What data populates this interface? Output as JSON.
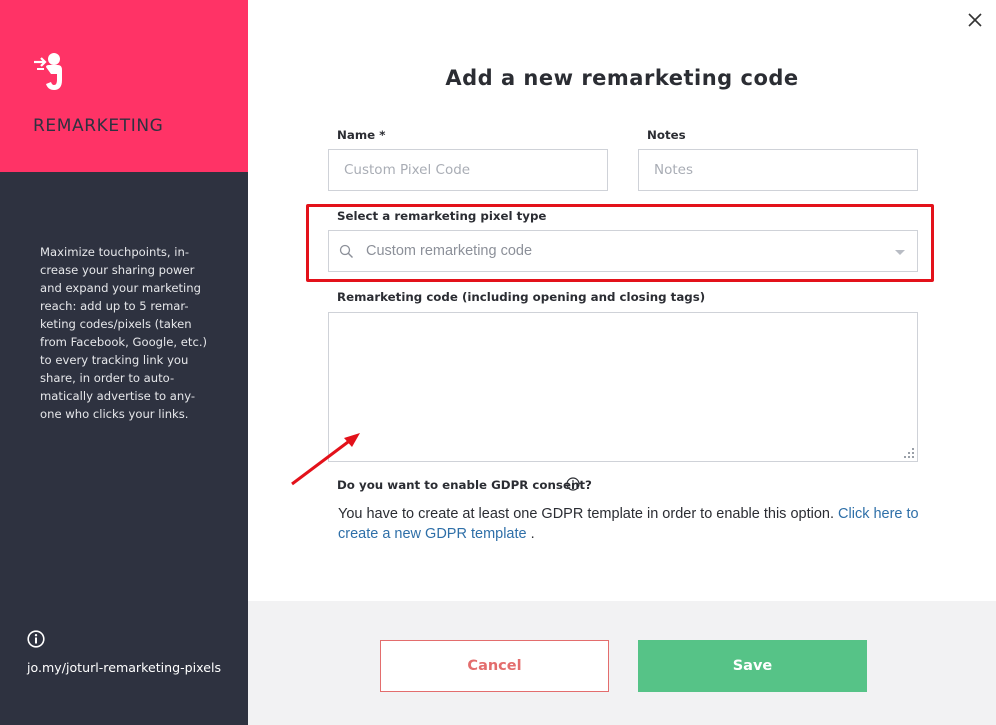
{
  "sidebar": {
    "brand_title": "REMARKETING",
    "description": "Maximize touchpoints, in-crease your sharing power and expand your marketing reach: add up to 5 remar-keting codes/pixels (taken from Facebook, Google, etc.) to every tracking link you share, in order to auto-matically advertise to any-one who clicks your links.",
    "help_link": "jo.my/joturl-remarketing-pixels",
    "colors": {
      "accent": "#ff3366",
      "dark": "#2e3240"
    }
  },
  "dialog": {
    "title": "Add a new remarketing code",
    "name_label": "Name *",
    "name_placeholder": "Custom Pixel Code",
    "notes_label": "Notes",
    "notes_placeholder": "Notes",
    "pixel_type_label": "Select a remarketing pixel type",
    "pixel_type_value": "Custom remarketing code",
    "code_label": "Remarketing code (including opening and closing tags)",
    "code_value": "",
    "gdpr_label": "Do you want to enable GDPR consent?",
    "gdpr_text": "You have to create at least one GDPR template in order to enable this option.",
    "gdpr_link": "Click here to create a new GDPR template",
    "gdpr_suffix": "."
  },
  "footer": {
    "cancel_label": "Cancel",
    "save_label": "Save",
    "colors": {
      "cancel": "#e36d6d",
      "save": "#56c387"
    }
  },
  "icons": {
    "brand": "remarketing-person-icon",
    "info": "info-icon",
    "close": "close-icon",
    "search": "search-icon"
  }
}
